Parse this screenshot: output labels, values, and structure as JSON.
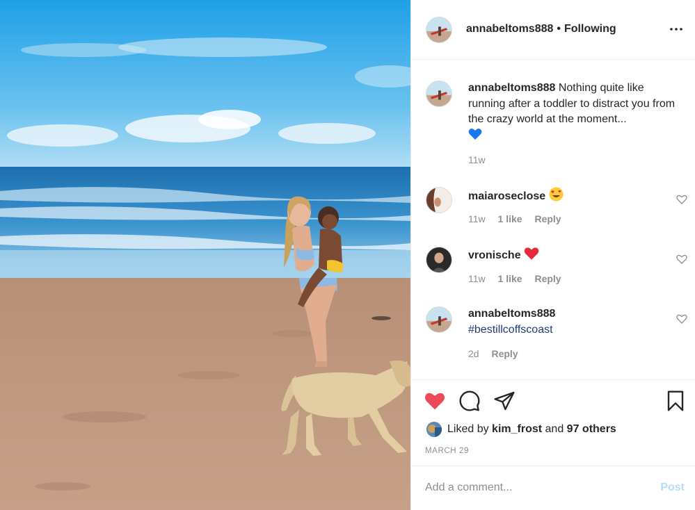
{
  "post": {
    "author": "annabeltoms888",
    "separator": "•",
    "follow_status": "Following"
  },
  "comments": [
    {
      "username": "annabeltoms888",
      "text": "Nothing quite like running after a toddler to distract you from the crazy world at the moment...",
      "emoji": "blue-heart",
      "age": "11w"
    },
    {
      "username": "maiaroseclose",
      "text": "",
      "emoji": "heart-eyes",
      "age": "11w",
      "likes": "1 like",
      "reply": "Reply"
    },
    {
      "username": "vronische",
      "text": "",
      "emoji": "red-heart",
      "age": "11w",
      "likes": "1 like",
      "reply": "Reply"
    },
    {
      "username": "annabeltoms888",
      "text": "#bestillcoffscoast",
      "age": "2d",
      "reply": "Reply"
    }
  ],
  "actions": {
    "liked_prefix": "Liked by ",
    "liked_user": "kim_frost",
    "liked_and": " and ",
    "liked_others": "97 others",
    "date": "MARCH 29"
  },
  "add_comment": {
    "placeholder": "Add a comment...",
    "post_label": "Post"
  },
  "colors": {
    "like_red": "#ed4956",
    "post_disabled": "#b2dffc",
    "hashtag": "#1f3d7a"
  }
}
